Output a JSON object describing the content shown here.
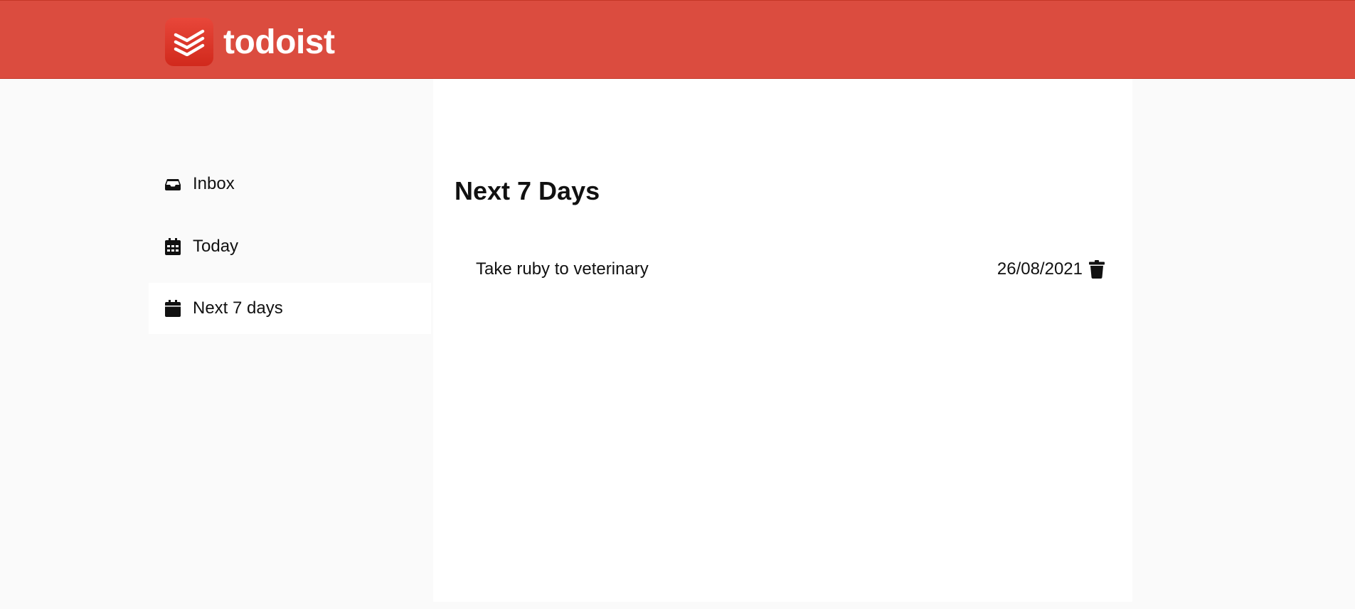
{
  "app": {
    "name": "todoist",
    "accent_color": "#db4c3f",
    "logo_icon": "todoist-logo-icon"
  },
  "sidebar": {
    "items": [
      {
        "label": "Inbox",
        "icon": "inbox-icon",
        "active": false
      },
      {
        "label": "Today",
        "icon": "calendar-grid-icon",
        "active": false
      },
      {
        "label": "Next 7 days",
        "icon": "calendar-icon",
        "active": true
      }
    ]
  },
  "main": {
    "title": "Next 7 Days",
    "tasks": [
      {
        "name": "Take ruby to veterinary",
        "date": "26/08/2021",
        "action_icon": "trash-icon"
      }
    ]
  }
}
